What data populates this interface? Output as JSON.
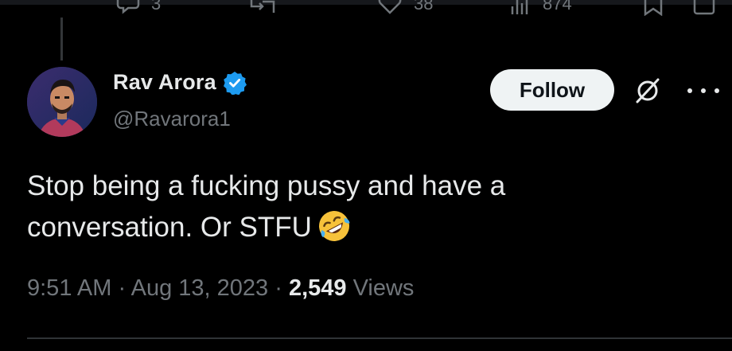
{
  "previous_tweet": {
    "reply_count": "3",
    "like_count": "38",
    "view_count": "874"
  },
  "author": {
    "display_name": "Rav Arora",
    "handle": "@Ravarora1",
    "verified": true
  },
  "header": {
    "follow_label": "Follow"
  },
  "tweet": {
    "line1": "Stop being a fucking pussy and have a",
    "line2": "conversation. Or STFU",
    "emoji": "rolling-on-the-floor-laughing-emoji"
  },
  "meta": {
    "time": "9:51 AM",
    "separator": "·",
    "date": "Aug 13, 2023",
    "views_count": "2,549",
    "views_label": "Views"
  },
  "colors": {
    "background": "#000000",
    "text": "#e7e9ea",
    "muted": "#71767b",
    "verified_blue": "#1d9bf0",
    "follow_bg": "#eff3f4"
  }
}
